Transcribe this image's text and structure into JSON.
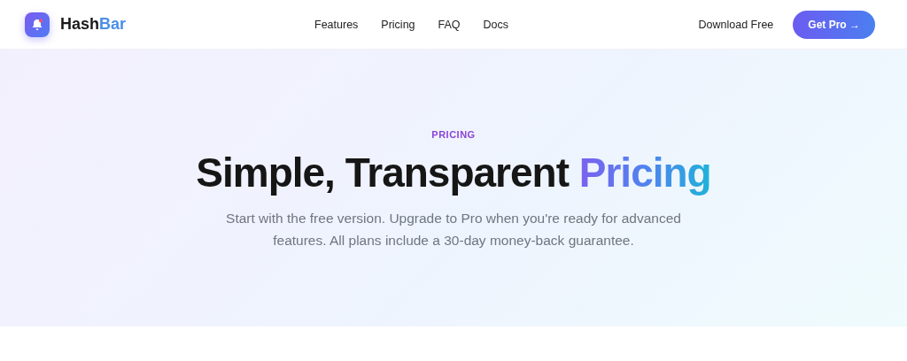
{
  "header": {
    "logo": {
      "name": "Hash",
      "name_accent": "Bar"
    },
    "nav": [
      {
        "label": "Features"
      },
      {
        "label": "Pricing"
      },
      {
        "label": "FAQ"
      },
      {
        "label": "Docs"
      }
    ],
    "download": "Download Free",
    "cta": "Get Pro →"
  },
  "hero": {
    "eyebrow": "PRICING",
    "title": "Simple, Transparent",
    "title_accent": "Pricing",
    "subtitle": "Start with the free version. Upgrade to Pro when you're ready for advanced features. All plans include a 30-day money-back guarantee."
  }
}
